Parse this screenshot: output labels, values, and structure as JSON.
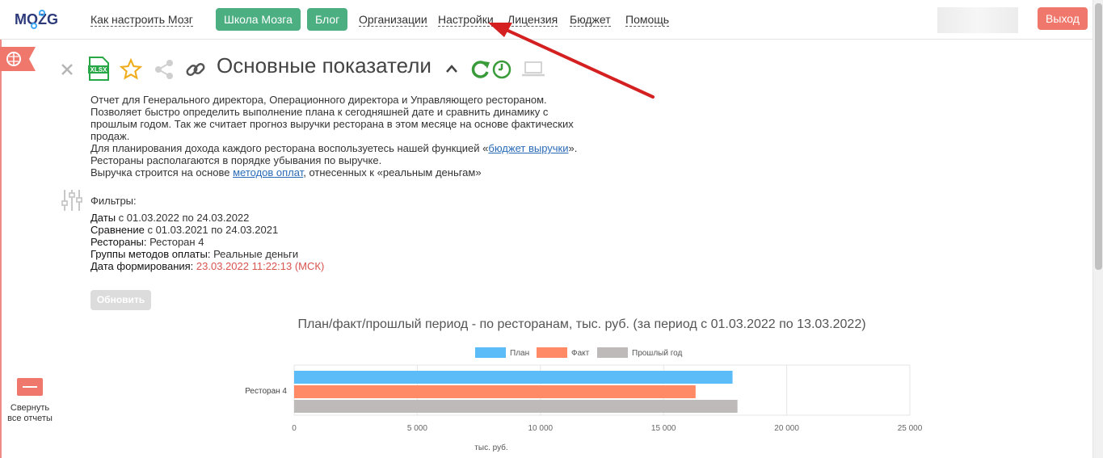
{
  "nav": {
    "logo": "MOZG",
    "links": [
      "Как настроить Мозг",
      "Организации",
      "Настройки",
      "Лицензия",
      "Бюджет",
      "Помощь"
    ],
    "pills": [
      "Школа Мозга",
      "Блог"
    ],
    "logout": "Выход"
  },
  "sidebar": {
    "collapse_label_1": "Свернуть",
    "collapse_label_2": "все отчеты"
  },
  "report": {
    "title": "Основные показатели",
    "xlsx_label": "XLSX",
    "description": [
      "Отчет для Генерального директора, Операционного директора и Управляющего рестораном.",
      "Позволяет быстро определить выполнение плана к сегодняшней дате и сравнить динамику с",
      "прошлым годом. Так же считает прогноз выручки ресторана в этом месяце на основе фактических",
      "продаж."
    ],
    "desc_budget_pre": "Для планирования дохода каждого ресторана воспользуетесь нашей функцией «",
    "desc_budget_link": "бюджет выручки",
    "desc_budget_post": "».",
    "desc_sort": "Рестораны располагаются в порядке убывания по выручке.",
    "desc_pay_pre": "Выручка строится на основе ",
    "desc_pay_link": "методов оплат",
    "desc_pay_post": ", отнесенных к «реальным деньгам»"
  },
  "filters": {
    "heading": "Фильтры:",
    "dates_label": "Даты",
    "dates_value": " с 01.03.2022 по 24.03.2022",
    "comparison_label": "Сравнение",
    "comparison_value": " с 01.03.2021 по 24.03.2021",
    "restaurants_label": "Рестораны:",
    "restaurants_value": " Ресторан 4",
    "payment_groups_label": "Группы методов оплаты:",
    "payment_groups_value": " Реальные деньги",
    "generated_label": "Дата формирования:",
    "generated_value": " 23.03.2022 11:22:13 (МСК)"
  },
  "update_button": "Обновить",
  "colors": {
    "plan": "#5bbcf7",
    "fact": "#ff8a65",
    "prev": "#bdbab9",
    "accent": "#4caf82",
    "danger": "#f0776b"
  },
  "chart_data": {
    "type": "bar",
    "orientation": "horizontal",
    "title": "План/факт/прошлый период - по ресторанам, тыс. руб. (за период с 01.03.2022 по 13.03.2022)",
    "categories": [
      "Ресторан 4"
    ],
    "series": [
      {
        "name": "План",
        "values": [
          17800
        ]
      },
      {
        "name": "Факт",
        "values": [
          16300
        ]
      },
      {
        "name": "Прошлый год",
        "values": [
          18000
        ]
      }
    ],
    "xlabel": "тыс. руб.",
    "ylabel": "",
    "xlim": [
      0,
      25000
    ],
    "ticks": [
      "0",
      "5 000",
      "10 000",
      "15 000",
      "20 000",
      "25 000"
    ],
    "tick_values": [
      0,
      5000,
      10000,
      15000,
      20000,
      25000
    ],
    "legend": "top",
    "grid": true
  }
}
